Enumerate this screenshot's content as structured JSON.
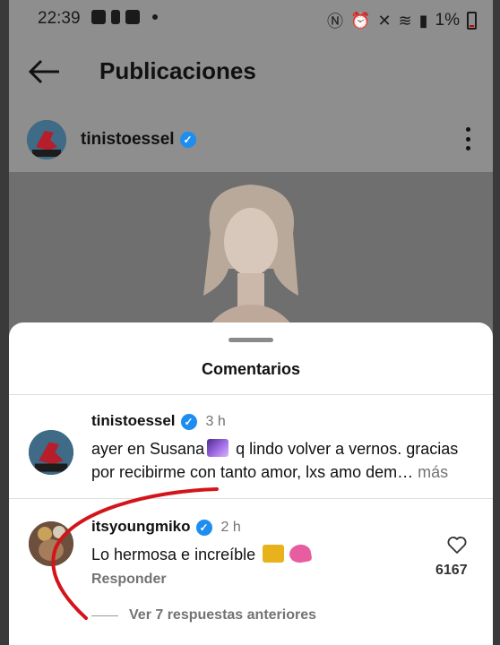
{
  "status": {
    "time": "22:39",
    "battery": "1%"
  },
  "header": {
    "title": "Publicaciones",
    "back_icon": "arrow-left-icon"
  },
  "post": {
    "username": "tinistoessel",
    "verified": true
  },
  "comments_sheet": {
    "title": "Comentarios",
    "comments": [
      {
        "username": "tinistoessel",
        "time": "3 h",
        "text_part1": "ayer en Susana",
        "text_part2": " q lindo volver a vernos. gracias",
        "text_line2": "por recibirme con tanto amor, lxs amo dem…",
        "more": "más"
      },
      {
        "username": "itsyoungmiko",
        "time": "2 h",
        "text": "Lo hermosa e increíble",
        "reply_label": "Responder",
        "likes": "6167",
        "view_replies": "Ver 7 respuestas anteriores"
      }
    ]
  },
  "colors": {
    "verified": "#1d8ef0",
    "annotation": "#d3151b"
  }
}
